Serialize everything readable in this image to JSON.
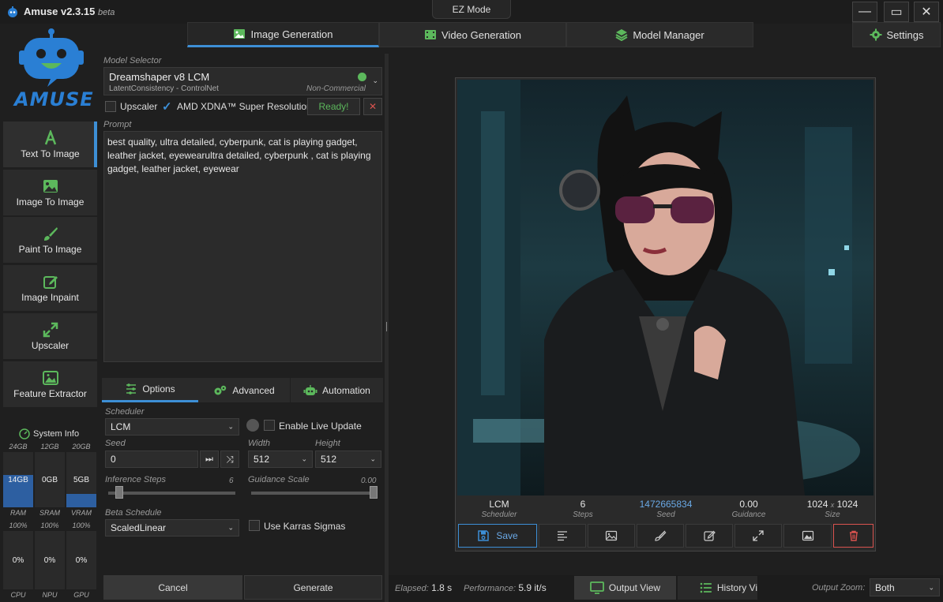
{
  "app": {
    "name": "Amuse v2.3.15",
    "beta": "beta",
    "ez_mode": "EZ Mode"
  },
  "window": {
    "minimize": "—",
    "maximize": "▭",
    "close": "✕"
  },
  "tabs": {
    "image_generation": "Image Generation",
    "video_generation": "Video Generation",
    "model_manager": "Model Manager",
    "settings": "Settings"
  },
  "logo": {
    "text": "AMUSE"
  },
  "sidebar": {
    "items": [
      {
        "label": "Text To Image"
      },
      {
        "label": "Image To Image"
      },
      {
        "label": "Paint To Image"
      },
      {
        "label": "Image Inpaint"
      },
      {
        "label": "Upscaler"
      },
      {
        "label": "Feature Extractor"
      }
    ]
  },
  "system_info": {
    "title": "System Info",
    "mem": [
      {
        "max": "24GB",
        "value": "14GB",
        "label": "RAM",
        "fill": 0.58
      },
      {
        "max": "12GB",
        "value": "0GB",
        "label": "SRAM",
        "fill": 0
      },
      {
        "max": "20GB",
        "value": "5GB",
        "label": "VRAM",
        "fill": 0.25
      }
    ],
    "proc": [
      {
        "max": "100%",
        "value": "0%",
        "label": "CPU"
      },
      {
        "max": "100%",
        "value": "0%",
        "label": "NPU"
      },
      {
        "max": "100%",
        "value": "0%",
        "label": "GPU"
      }
    ]
  },
  "model": {
    "section_label": "Model Selector",
    "name": "Dreamshaper v8 LCM",
    "sub": "LatentConsistency - ControlNet",
    "license": "Non-Commercial",
    "upscaler_label": "Upscaler",
    "amd_label": "AMD XDNA™ Super Resolution",
    "ready": "Ready!",
    "cancel_x": "✕"
  },
  "prompt": {
    "label": "Prompt",
    "text": "best quality, ultra detailed, cyberpunk, cat is playing gadget, leather jacket, eyewearultra detailed, cyberpunk , cat is playing gadget, leather jacket, eyewear"
  },
  "subtabs": {
    "options": "Options",
    "advanced": "Advanced",
    "automation": "Automation"
  },
  "options": {
    "scheduler_label": "Scheduler",
    "scheduler": "LCM",
    "live_update_label": "Enable Live Update",
    "seed_label": "Seed",
    "seed": "0",
    "width_label": "Width",
    "width": "512",
    "height_label": "Height",
    "height": "512",
    "steps_label": "Inference Steps",
    "steps": "6",
    "steps_fraction": 0.06,
    "guidance_label": "Guidance Scale",
    "guidance": "0.00",
    "guidance_fraction": 1.0,
    "beta_label": "Beta Schedule",
    "beta": "ScaledLinear",
    "karras_label": "Use Karras Sigmas"
  },
  "actions": {
    "cancel": "Cancel",
    "generate": "Generate"
  },
  "result": {
    "scheduler": "LCM",
    "scheduler_label": "Scheduler",
    "steps": "6",
    "steps_label": "Steps",
    "seed": "1472665834",
    "seed_label": "Seed",
    "guidance": "0.00",
    "guidance_label": "Guidance",
    "size_w": "1024",
    "size_x": "x",
    "size_h": "1024",
    "size_label": "Size",
    "save": "Save"
  },
  "status": {
    "elapsed_label": "Elapsed:",
    "elapsed": "1.8 s",
    "perf_label": "Performance:",
    "perf": "5.9 it/s",
    "output_view": "Output View",
    "history_view": "History Vi",
    "zoom_label": "Output Zoom:",
    "zoom": "Both"
  },
  "colors": {
    "accent": "#3d8fd6",
    "ready": "#5cb85c",
    "danger": "#d9534f",
    "panel": "#2b2b2b",
    "logo": "#2a7fd4"
  }
}
